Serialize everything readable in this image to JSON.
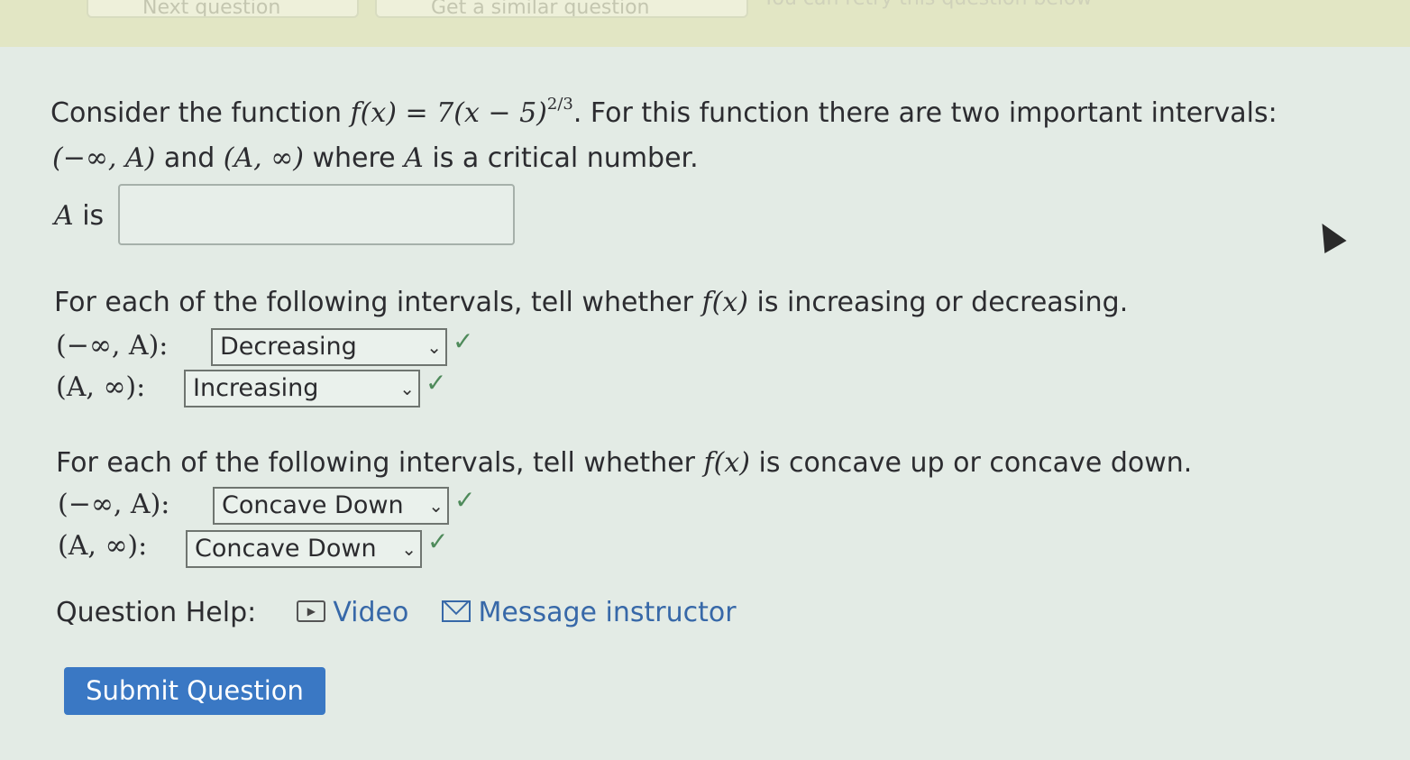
{
  "top_nav": {
    "next_label": "Next question",
    "similar_label": "Get a similar question",
    "retry_text": "You can retry this question below"
  },
  "problem": {
    "intro_text": "Consider the function ",
    "function_expr": "f(x) = 7(x − 5)",
    "exponent": "2/3",
    "intro_rest": ". For this function there are two important intervals:",
    "interval_left": "(−∞, A)",
    "and_text": " and ",
    "interval_right": "(A, ∞)",
    "where_text": " where ",
    "var_a": "A",
    "critical_text": " is a critical number.",
    "a_is_label": " is",
    "a_value": ""
  },
  "increasing_section": {
    "prompt_start": "For each of the following intervals, tell whether ",
    "fx": "f(x)",
    "prompt_end": " is increasing or decreasing.",
    "rows": [
      {
        "interval": "(−∞, A):",
        "selected": "Decreasing",
        "status": "correct"
      },
      {
        "interval": "(A, ∞):",
        "selected": "Increasing",
        "status": "correct"
      }
    ]
  },
  "concavity_section": {
    "prompt_start": "For each of the following intervals, tell whether ",
    "fx": "f(x)",
    "prompt_end": " is concave up or concave down.",
    "rows": [
      {
        "interval": "(−∞, A):",
        "selected": "Concave Down",
        "status": "correct"
      },
      {
        "interval": "(A, ∞):",
        "selected": "Concave Down",
        "status": "correct"
      }
    ]
  },
  "help": {
    "label": "Question Help:",
    "video_label": "Video",
    "message_label": "Message instructor"
  },
  "submit_label": "Submit Question",
  "icons": {
    "check": "✓",
    "chevron": "⌄"
  },
  "colors": {
    "submit_bg": "#3a78c4",
    "link": "#3768a8",
    "check": "#4e8a5a"
  }
}
